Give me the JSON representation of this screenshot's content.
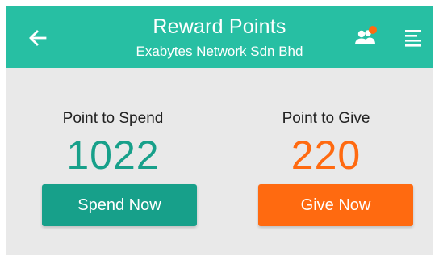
{
  "header": {
    "title": "Reward Points",
    "subtitle": "Exabytes Network Sdn Bhd",
    "icons": {
      "back": "arrow-left-icon",
      "people": "people-icon",
      "menu": "menu-icon"
    }
  },
  "spend": {
    "label": "Point to Spend",
    "value": "1022",
    "button_label": "Spend Now"
  },
  "give": {
    "label": "Point to Give",
    "value": "220",
    "button_label": "Give Now"
  },
  "colors": {
    "header_bg": "#27bfa3",
    "spend_accent": "#17a08a",
    "give_accent": "#ff6a10",
    "notification_dot": "#ff6a10",
    "content_bg": "#e9e9e9"
  }
}
